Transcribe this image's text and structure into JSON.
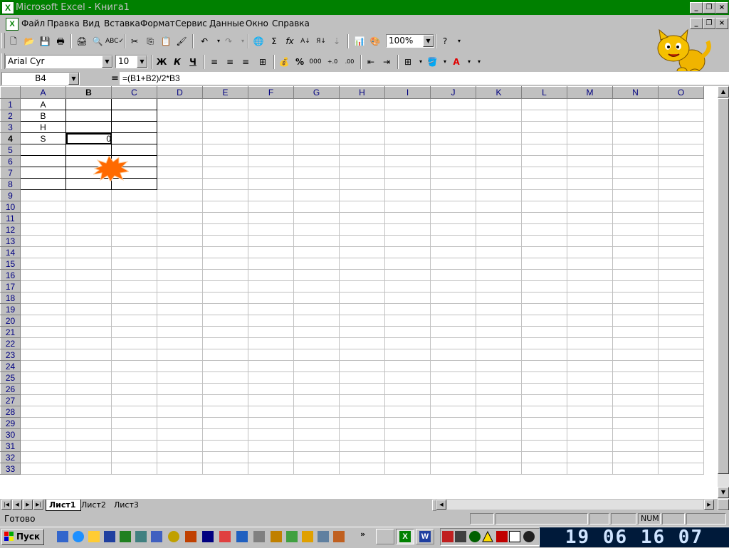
{
  "window": {
    "title": "Microsoft Excel - Книга1"
  },
  "menu": [
    "Файл",
    "Правка",
    "Вид",
    "Вставка",
    "Формат",
    "Сервис",
    "Данные",
    "Окно",
    "Справка"
  ],
  "toolbar": {
    "zoom": "100%"
  },
  "formatting": {
    "font": "Arial Cyr",
    "size": "10",
    "bold": "Ж",
    "italic": "К",
    "underline": "Ч"
  },
  "formula": {
    "cell_ref": "B4",
    "eq": "=",
    "content": "=(B1+B2)/2*B3"
  },
  "columns": [
    "A",
    "B",
    "C",
    "D",
    "E",
    "F",
    "G",
    "H",
    "I",
    "J",
    "K",
    "L",
    "M",
    "N",
    "O"
  ],
  "rows": 33,
  "cells": {
    "A1": "A",
    "A2": "B",
    "A3": "H",
    "A4": "S",
    "B4": "0"
  },
  "sheets": [
    "Лист1",
    "Лист2",
    "Лист3"
  ],
  "status": {
    "ready": "Готово",
    "num": "NUM"
  },
  "taskbar": {
    "start": "Пуск",
    "clock": "19 06 16 07"
  },
  "colors": {
    "title_bg": "#008000",
    "title_text": "#c0c0c0",
    "burst": "#ff6a00"
  }
}
